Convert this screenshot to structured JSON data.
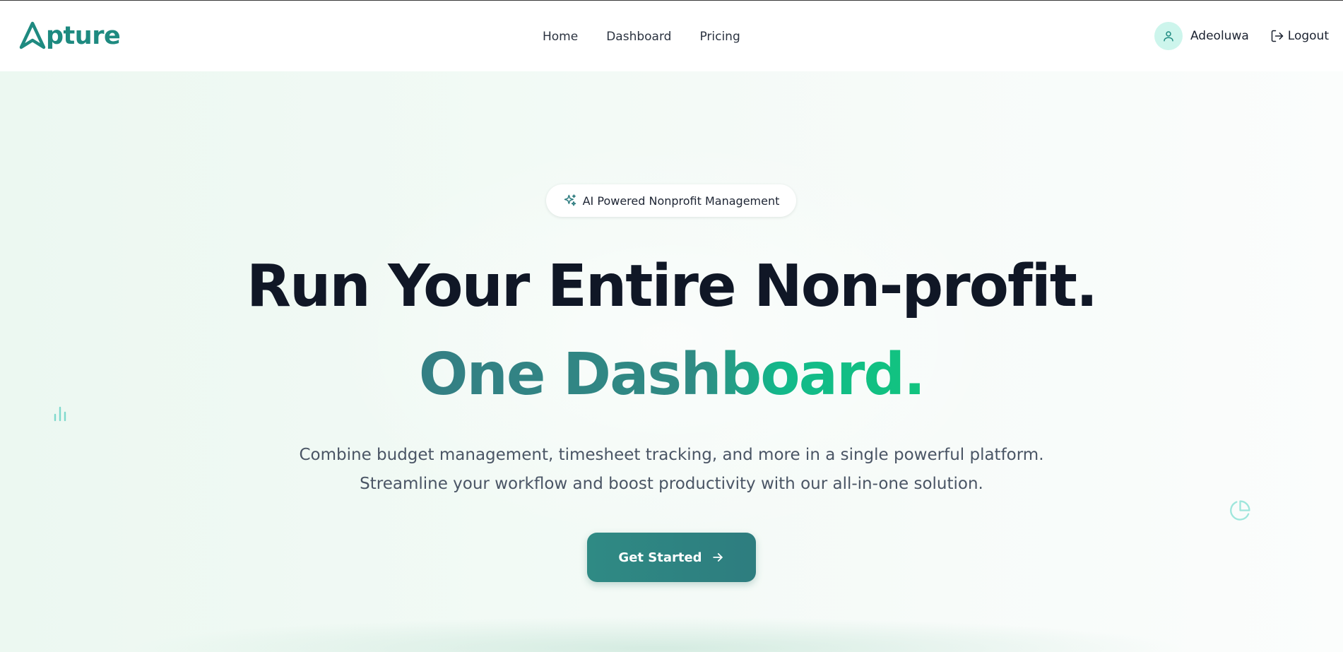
{
  "brand": {
    "name": "pture",
    "color": "#1e8a80"
  },
  "nav": {
    "links": [
      {
        "label": "Home"
      },
      {
        "label": "Dashboard"
      },
      {
        "label": "Pricing"
      }
    ]
  },
  "user": {
    "name": "Adeoluwa",
    "logout_label": "Logout",
    "avatar_icon": "user-icon"
  },
  "hero": {
    "badge": {
      "icon": "sparkles-icon",
      "label": "AI Powered Nonprofit Management"
    },
    "headline_line1": "Run Your Entire Non-profit.",
    "headline_line2": "One Dashboard.",
    "description_line1": "Combine budget management, timesheet tracking, and more in a single powerful platform.",
    "description_line2": "Streamline your workflow and boost productivity with our all-in-one solution.",
    "cta": {
      "label": "Get Started",
      "icon": "arrow-right-icon"
    },
    "decorations": [
      "bar-chart-icon",
      "pie-chart-icon"
    ]
  },
  "colors": {
    "accent": "#2f8a84",
    "accent_green": "#12c47f",
    "heading": "#101726",
    "body_text": "#4a5565"
  }
}
